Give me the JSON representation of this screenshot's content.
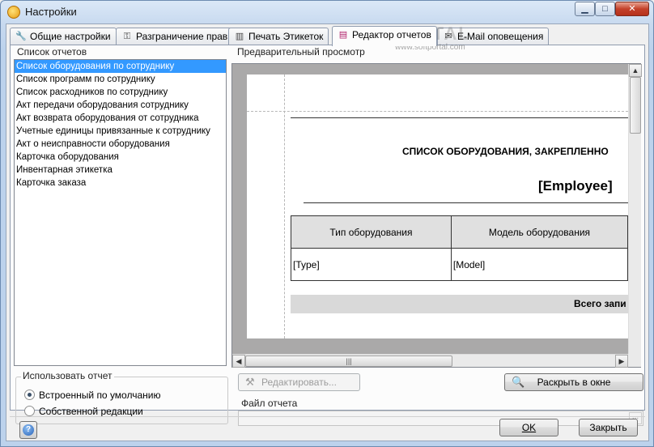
{
  "window": {
    "title": "Настройки"
  },
  "tabs": [
    {
      "label": "Общие настройки",
      "icon": "wrench-icon"
    },
    {
      "label": "Разграничение прав",
      "icon": "key-icon"
    },
    {
      "label": "Печать Этикеток",
      "icon": "barcode-icon"
    },
    {
      "label": "Редактор отчетов",
      "icon": "report-icon",
      "active": true
    },
    {
      "label": "E-Mail оповещения",
      "icon": "mail-icon"
    }
  ],
  "reports_list": {
    "label": "Список отчетов",
    "items": [
      "Список оборудования по сотруднику",
      "Список программ по сотруднику",
      "Список расходников по сотруднику",
      "Акт передачи оборудования сотруднику",
      "Акт возврата оборудования от сотрудника",
      "Учетные единицы привязанные к сотруднику",
      "Акт о неисправности оборудования",
      "Карточка оборудования",
      "Инвентарная этикетка",
      "Карточка заказа"
    ],
    "selected_index": 0
  },
  "preview": {
    "label": "Предварительный просмотр",
    "doc_title": "СПИСОК ОБОРУДОВАНИЯ, ЗАКРЕПЛЕННО",
    "employee": "[Employee]",
    "col1_header": "Тип оборудования",
    "col2_header": "Модель оборудования",
    "col1_value": "[Type]",
    "col2_value": "[Model]",
    "total": "Всего запи"
  },
  "use_report": {
    "label": "Использовать отчет",
    "options": [
      {
        "label": "Встроенный по умолчанию",
        "checked": true
      },
      {
        "label": "Собственной редакции",
        "checked": false
      }
    ]
  },
  "buttons": {
    "edit": "Редактировать...",
    "open_window": "Раскрыть в окне",
    "ok": "OK",
    "close": "Закрыть"
  },
  "report_file": {
    "label": "Файл отчета",
    "value": "",
    "browse": "..."
  },
  "watermark": {
    "text": "PORTAL",
    "sub": "www.softportal.com"
  }
}
